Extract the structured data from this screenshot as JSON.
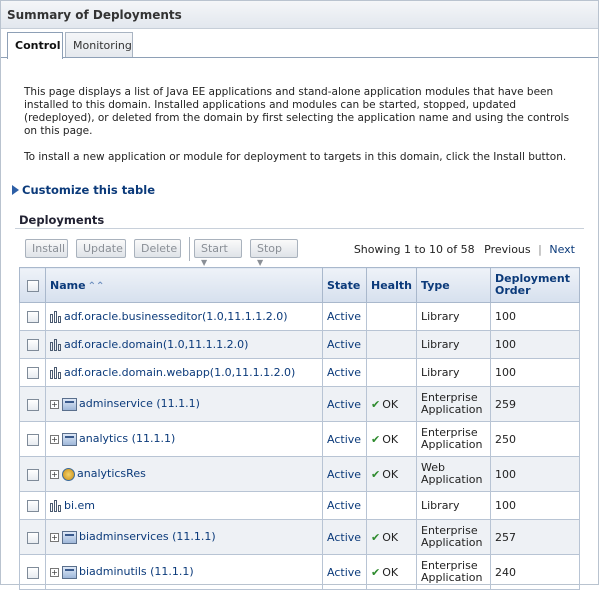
{
  "window": {
    "title": "Summary of Deployments"
  },
  "tabs": [
    {
      "label": "Control",
      "active": true
    },
    {
      "label": "Monitoring",
      "active": false
    }
  ],
  "intro": {
    "p1": "This page displays a list of Java EE applications and stand-alone application modules that have been installed to this domain. Installed applications and modules can be started, stopped, updated (redeployed), or deleted from the domain by first selecting the application name and using the controls on this page.",
    "p2": "To install a new application or module for deployment to targets in this domain, click the Install button."
  },
  "customize_label": "Customize this table",
  "section_title": "Deployments",
  "toolbar": {
    "install": "Install",
    "update": "Update",
    "delete": "Delete",
    "start": "Start",
    "stop": "Stop",
    "showing": "Showing 1 to 10 of 58",
    "previous": "Previous",
    "separator": "|",
    "next": "Next"
  },
  "table": {
    "headers": {
      "name": "Name",
      "state": "State",
      "health": "Health",
      "type": "Type",
      "order": "Deployment Order"
    },
    "rows": [
      {
        "name": "adf.oracle.businesseditor(1.0,11.1.1.2.0)",
        "state": "Active",
        "health": "",
        "type": "Library",
        "order": "100",
        "icon": "library-icon"
      },
      {
        "name": "adf.oracle.domain(1.0,11.1.1.2.0)",
        "state": "Active",
        "health": "",
        "type": "Library",
        "order": "100",
        "icon": "library-icon"
      },
      {
        "name": "adf.oracle.domain.webapp(1.0,11.1.1.2.0)",
        "state": "Active",
        "health": "",
        "type": "Library",
        "order": "100",
        "icon": "library-icon"
      },
      {
        "name": "adminservice (11.1.1)",
        "state": "Active",
        "health": "OK",
        "type": "Enterprise Application",
        "order": "259",
        "icon": "enterprise-app-icon"
      },
      {
        "name": "analytics (11.1.1)",
        "state": "Active",
        "health": "OK",
        "type": "Enterprise Application",
        "order": "250",
        "icon": "enterprise-app-icon"
      },
      {
        "name": "analyticsRes",
        "state": "Active",
        "health": "OK",
        "type": "Web Application",
        "order": "100",
        "icon": "web-app-icon"
      },
      {
        "name": "bi.em",
        "state": "Active",
        "health": "",
        "type": "Library",
        "order": "100",
        "icon": "library-icon"
      },
      {
        "name": "biadminservices (11.1.1)",
        "state": "Active",
        "health": "OK",
        "type": "Enterprise Application",
        "order": "257",
        "icon": "enterprise-app-icon"
      },
      {
        "name": "biadminutils (11.1.1)",
        "state": "Active",
        "health": "OK",
        "type": "Enterprise Application",
        "order": "240",
        "icon": "enterprise-app-icon"
      }
    ]
  }
}
